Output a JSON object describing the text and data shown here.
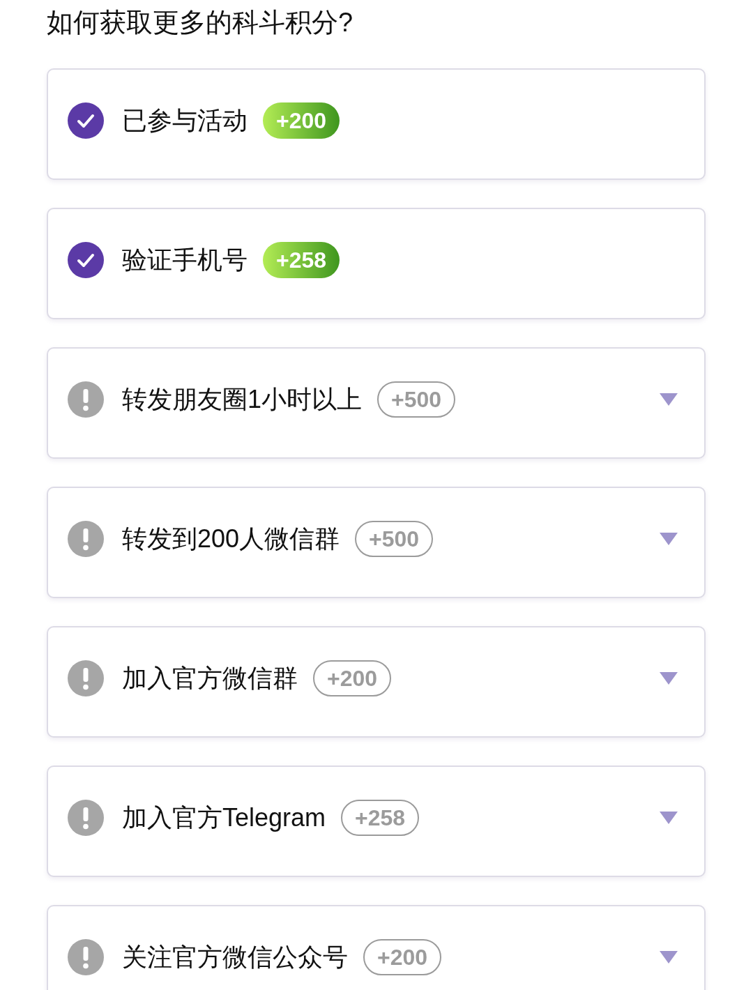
{
  "title": "如何获取更多的科斗积分?",
  "tasks": [
    {
      "label": "已参与活动",
      "points": "+200",
      "completed": true
    },
    {
      "label": "验证手机号",
      "points": "+258",
      "completed": true
    },
    {
      "label": "转发朋友圈1小时以上",
      "points": "+500",
      "completed": false
    },
    {
      "label": "转发到200人微信群",
      "points": "+500",
      "completed": false
    },
    {
      "label": "加入官方微信群",
      "points": "+200",
      "completed": false
    },
    {
      "label": "加入官方Telegram",
      "points": "+258",
      "completed": false
    },
    {
      "label": "关注官方微信公众号",
      "points": "+200",
      "completed": false
    }
  ]
}
